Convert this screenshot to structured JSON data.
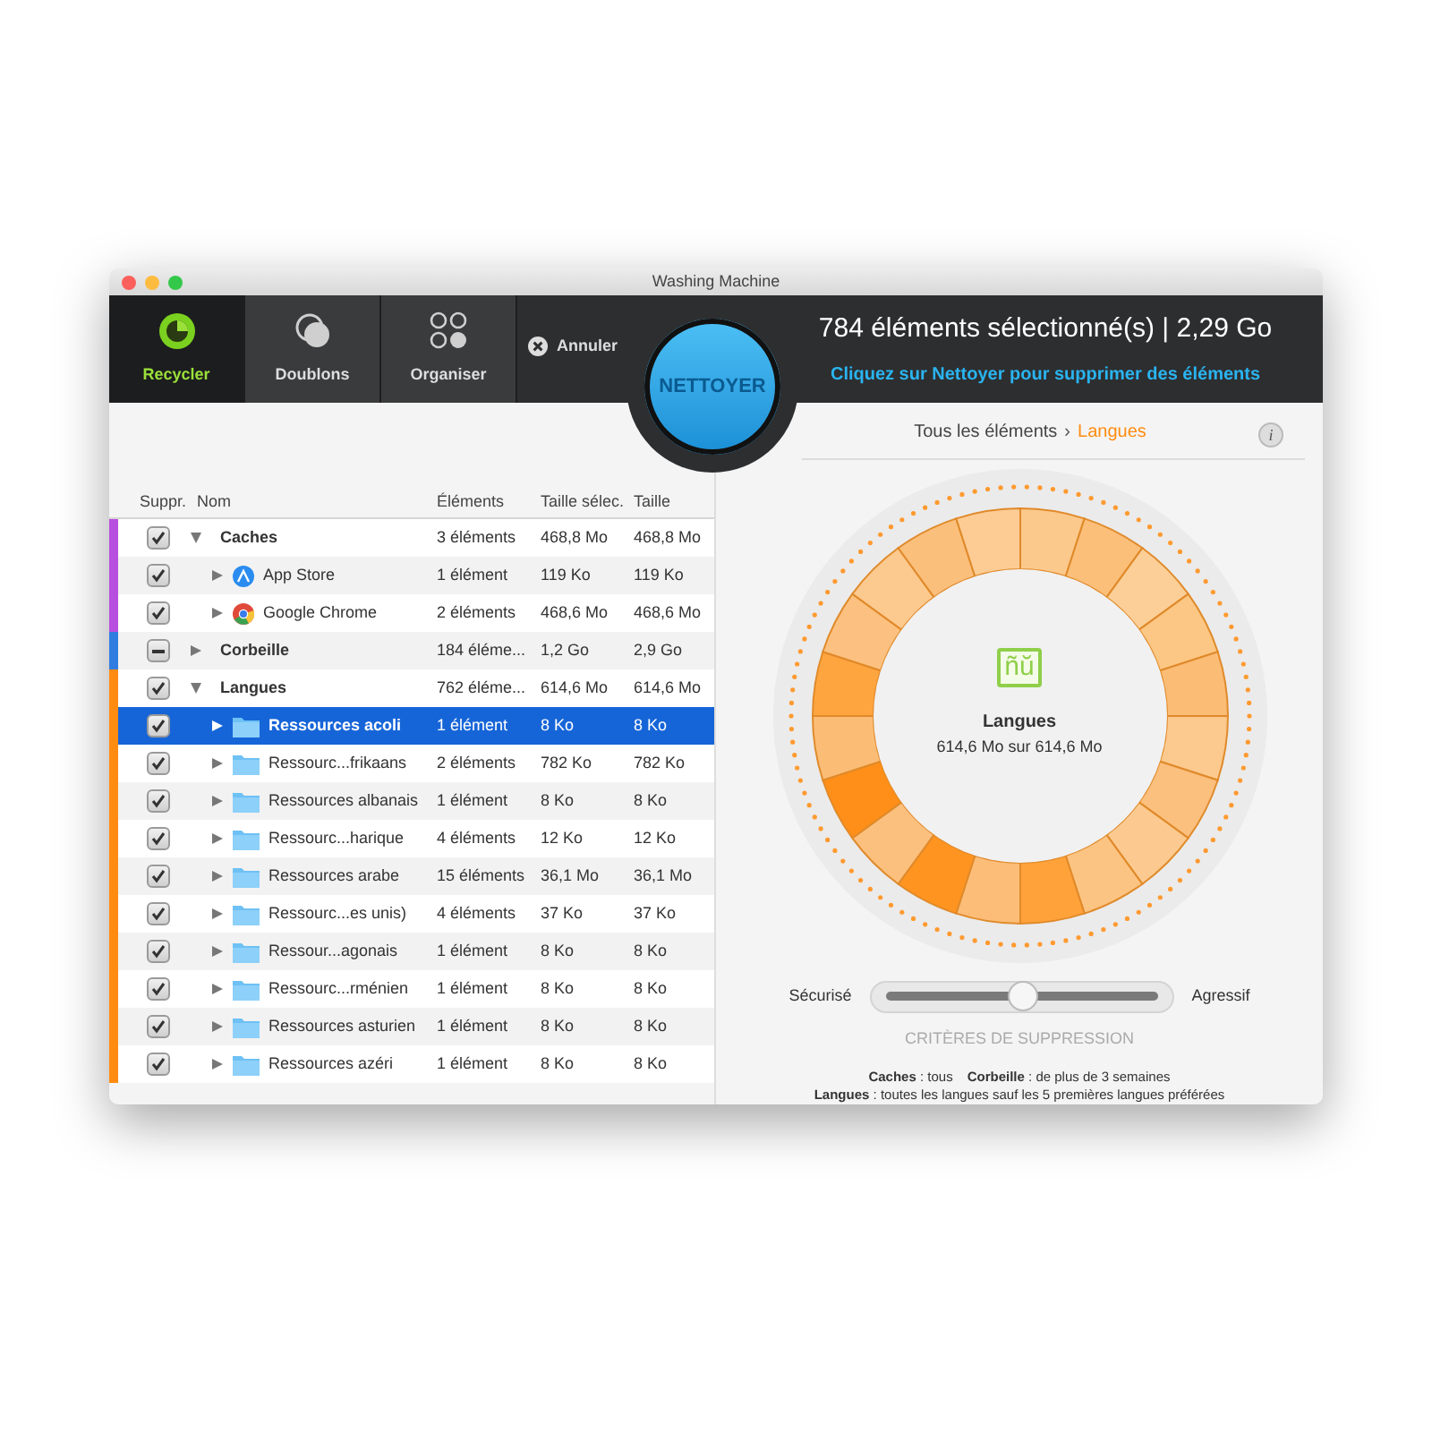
{
  "window": {
    "title": "Washing Machine"
  },
  "toolbar": {
    "tabs": [
      {
        "label": "Recycler",
        "selected": true,
        "kind": "recycle"
      },
      {
        "label": "Doublons",
        "selected": false,
        "kind": "duplicates"
      },
      {
        "label": "Organiser",
        "selected": false,
        "kind": "organize"
      }
    ],
    "cancel": "Annuler",
    "clean_button": "NETTOYER",
    "summary": "784 éléments sélectionné(s) | 2,29 Go",
    "hint": "Cliquez sur Nettoyer pour supprimer des éléments"
  },
  "table": {
    "columns": [
      "Suppr.",
      "Nom",
      "Éléments",
      "Taille sélec.",
      "Taille"
    ],
    "rows": [
      {
        "name": "Caches",
        "checked": true,
        "mixed": false,
        "expanded": true,
        "selected": false,
        "color": "#b84ee0",
        "count": "3 éléments",
        "selected_size": "468,8 Mo",
        "size": "468,8 Mo",
        "children": [
          {
            "name": "App Store",
            "checked": true,
            "mixed": false,
            "expanded": false,
            "selected": false,
            "kind": "appstore",
            "count": "1 élément",
            "selected_size": "119 Ko",
            "size": "119 Ko"
          },
          {
            "name": "Google Chrome",
            "checked": true,
            "mixed": false,
            "expanded": false,
            "selected": false,
            "kind": "chrome",
            "count": "2 éléments",
            "selected_size": "468,6 Mo",
            "size": "468,6 Mo"
          }
        ]
      },
      {
        "name": "Corbeille",
        "checked": true,
        "mixed": true,
        "expanded": false,
        "selected": false,
        "color": "#2f7de0",
        "count": "184 éléme...",
        "selected_size": "1,2 Go",
        "size": "2,9 Go"
      },
      {
        "name": "Langues",
        "checked": true,
        "mixed": false,
        "expanded": true,
        "selected": false,
        "color": "#ff8c10",
        "count": "762 éléme...",
        "selected_size": "614,6 Mo",
        "size": "614,6 Mo",
        "children": [
          {
            "name": "Ressources acoli",
            "checked": true,
            "mixed": false,
            "expanded": false,
            "selected": true,
            "kind": "folder",
            "count": "1 élément",
            "selected_size": "8 Ko",
            "size": "8 Ko"
          },
          {
            "name": "Ressourc...frikaans",
            "checked": true,
            "mixed": false,
            "expanded": false,
            "selected": false,
            "kind": "folder",
            "count": "2 éléments",
            "selected_size": "782 Ko",
            "size": "782 Ko"
          },
          {
            "name": "Ressources albanais",
            "checked": true,
            "mixed": false,
            "expanded": false,
            "selected": false,
            "kind": "folder",
            "count": "1 élément",
            "selected_size": "8 Ko",
            "size": "8 Ko"
          },
          {
            "name": "Ressourc...harique",
            "checked": true,
            "mixed": false,
            "expanded": false,
            "selected": false,
            "kind": "folder",
            "count": "4 éléments",
            "selected_size": "12 Ko",
            "size": "12 Ko"
          },
          {
            "name": "Ressources arabe",
            "checked": true,
            "mixed": false,
            "expanded": false,
            "selected": false,
            "kind": "folder",
            "count": "15 éléments",
            "selected_size": "36,1 Mo",
            "size": "36,1 Mo"
          },
          {
            "name": "Ressourc...es unis)",
            "checked": true,
            "mixed": false,
            "expanded": false,
            "selected": false,
            "kind": "folder",
            "count": "4 éléments",
            "selected_size": "37 Ko",
            "size": "37 Ko"
          },
          {
            "name": "Ressour...agonais",
            "checked": true,
            "mixed": false,
            "expanded": false,
            "selected": false,
            "kind": "folder",
            "count": "1 élément",
            "selected_size": "8 Ko",
            "size": "8 Ko"
          },
          {
            "name": "Ressourc...rménien",
            "checked": true,
            "mixed": false,
            "expanded": false,
            "selected": false,
            "kind": "folder",
            "count": "1 élément",
            "selected_size": "8 Ko",
            "size": "8 Ko"
          },
          {
            "name": "Ressources asturien",
            "checked": true,
            "mixed": false,
            "expanded": false,
            "selected": false,
            "kind": "folder",
            "count": "1 élément",
            "selected_size": "8 Ko",
            "size": "8 Ko"
          },
          {
            "name": "Ressources azéri",
            "checked": true,
            "mixed": false,
            "expanded": false,
            "selected": false,
            "kind": "folder",
            "count": "1 élément",
            "selected_size": "8 Ko",
            "size": "8 Ko"
          }
        ]
      }
    ]
  },
  "detail": {
    "breadcrumb": [
      {
        "label": "Tous les éléments",
        "selected": false
      },
      {
        "label": "Langues",
        "selected": true
      }
    ],
    "separator": "›",
    "info": "i",
    "ring_icon_text": "ñŭ",
    "title": "Langues",
    "subtitle": "614,6 Mo sur 614,6 Mo",
    "slider": {
      "left": "Sécurisé",
      "right": "Agressif",
      "level": 0.5,
      "caption": "CRITÈRES DE SUPPRESSION"
    },
    "criteria": [
      [
        "**Caches** : tous",
        "**Corbeille** : de plus de 3 semaines"
      ],
      [
        "**Langues** : toutes les langues sauf les 5 premières langues préférées"
      ]
    ]
  }
}
